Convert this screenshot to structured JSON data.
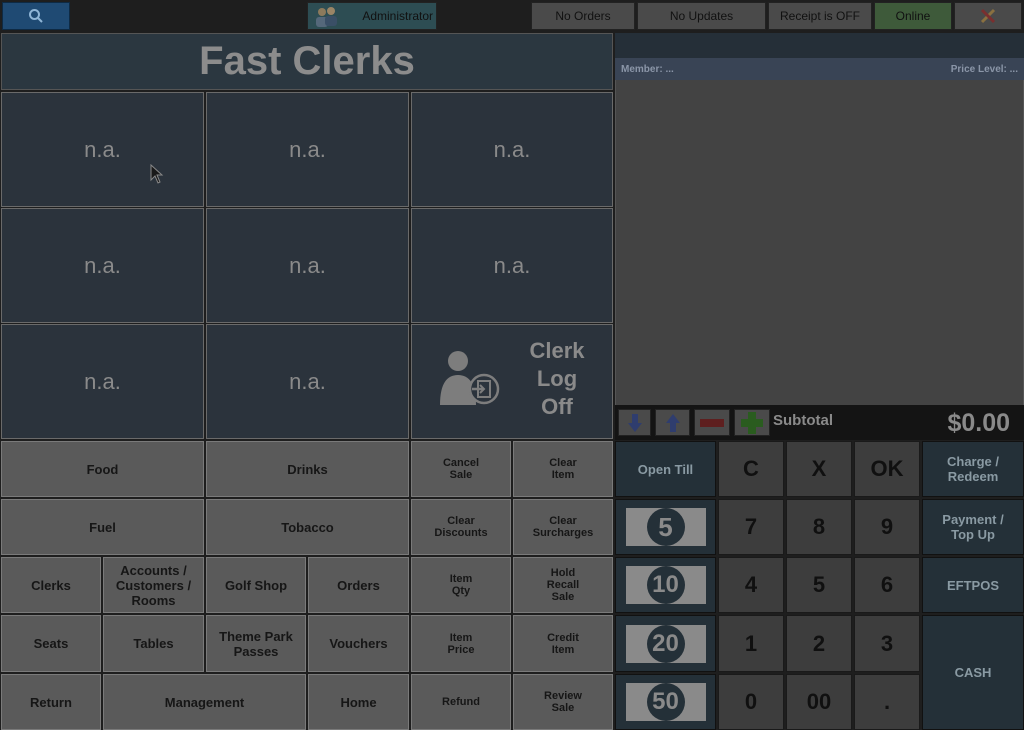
{
  "topbar": {
    "user": "Administrator",
    "orders": "No Orders",
    "updates": "No Updates",
    "receipt": "Receipt is OFF",
    "status": "Online"
  },
  "clerks": {
    "title": "Fast Clerks",
    "tile": "n.a.",
    "logoff": "Clerk\nLog\nOff"
  },
  "receipt": {
    "member": "Member: ...",
    "price_level": "Price Level: ...",
    "subtotal_label": "Subtotal",
    "subtotal_value": "$0.00"
  },
  "functions": {
    "food": "Food",
    "drinks": "Drinks",
    "fuel": "Fuel",
    "tobacco": "Tobacco",
    "clerks": "Clerks",
    "accounts": "Accounts / Customers / Rooms",
    "golf_shop": "Golf Shop",
    "orders": "Orders",
    "seats": "Seats",
    "tables": "Tables",
    "theme_park": "Theme Park Passes",
    "vouchers": "Vouchers",
    "return": "Return",
    "management": "Management",
    "home": "Home",
    "cancel_sale": "Cancel Sale",
    "clear_item": "Clear Item",
    "clear_discounts": "Clear Discounts",
    "clear_surcharges": "Clear Surcharges",
    "item_qty": "Item Qty",
    "hold_recall": "Hold Recall Sale",
    "item_price": "Item Price",
    "credit_item": "Credit Item",
    "refund": "Refund",
    "review_sale": "Review Sale"
  },
  "tender": {
    "open_till": "Open Till",
    "notes": [
      "5",
      "10",
      "20",
      "50"
    ],
    "clear": "C",
    "x": "X",
    "ok": "OK",
    "digits": [
      "7",
      "8",
      "9",
      "4",
      "5",
      "6",
      "1",
      "2",
      "3",
      "0",
      "00",
      "."
    ],
    "charge": "Charge / Redeem",
    "payment": "Payment / Top Up",
    "eftpos": "EFTPOS",
    "cash": "CASH"
  }
}
